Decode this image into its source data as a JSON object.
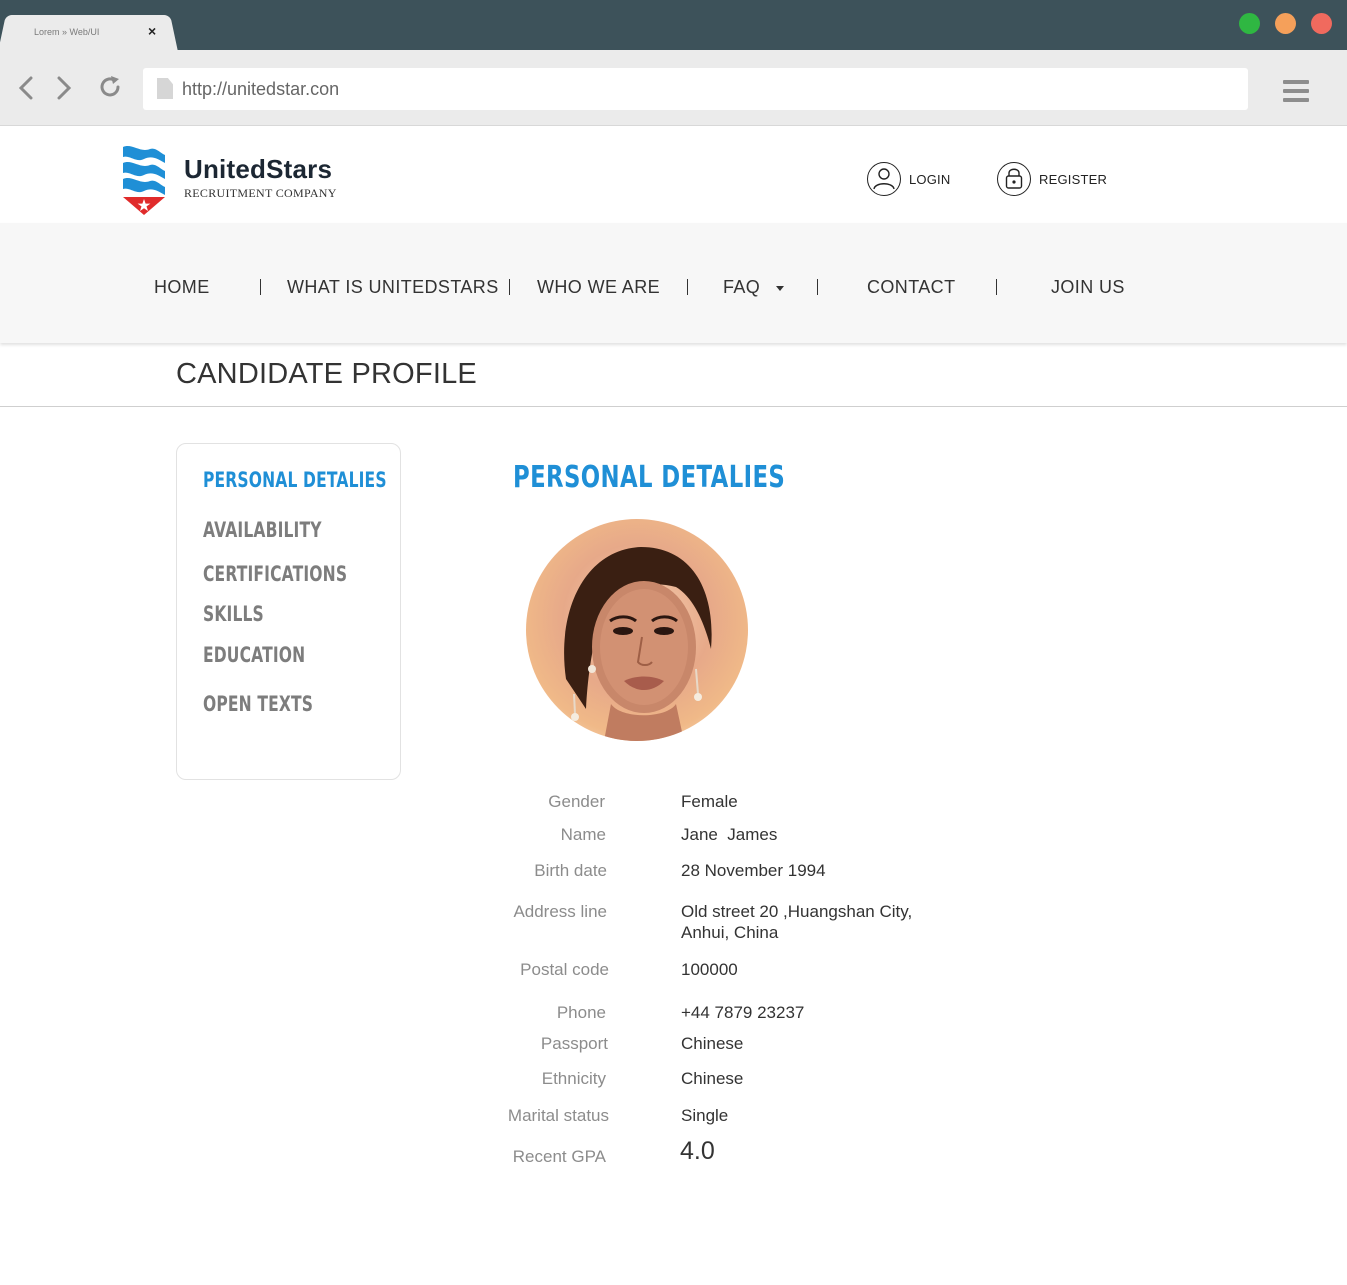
{
  "browser": {
    "tab_title": "Lorem » Web/UI",
    "tab_close": "×",
    "url": "http://unitedstar.con",
    "window_dots": [
      "#2fb742",
      "#f5a05a",
      "#f06a5e"
    ]
  },
  "header": {
    "brand_name": "UnitedStars",
    "brand_subtitle": "RECRUITMENT COMPANY",
    "login_label": "LOGIN",
    "register_label": "REGISTER"
  },
  "nav": {
    "items": [
      "HOME",
      "WHAT IS UNITEDSTARS",
      "WHO WE ARE",
      "FAQ",
      "CONTACT",
      "JOIN US"
    ]
  },
  "page": {
    "title": "CANDIDATE PROFILE",
    "section_title": "PERSONAL DETALIES"
  },
  "sidebar": {
    "items": [
      "PERSONAL DETALIES",
      "AVAILABILITY",
      "CERTIFICATIONS",
      "SKILLS",
      "EDUCATION",
      "OPEN TEXTS"
    ],
    "active": "PERSONAL DETALIES"
  },
  "profile": {
    "fields": [
      {
        "label": "Gender",
        "value": "Female"
      },
      {
        "label": "Name",
        "value": "Jane  James"
      },
      {
        "label": "Birth date",
        "value": "28 November 1994"
      },
      {
        "label": "Address line",
        "value": "Old street 20 ,Huangshan City,",
        "value2": "Anhui, China"
      },
      {
        "label": "Postal code",
        "value": "100000"
      },
      {
        "label": "Phone",
        "value": "+44 7879 23237"
      },
      {
        "label": "Passport",
        "value": "Chinese"
      },
      {
        "label": "Ethnicity",
        "value": "Chinese"
      },
      {
        "label": "Marital status",
        "value": "Single"
      },
      {
        "label": "Recent GPA",
        "value": "4.0"
      }
    ]
  },
  "colors": {
    "accent": "#1f8fd6",
    "chrome_dark": "#3d525a",
    "logo_blue": "#1f8fd6",
    "logo_red": "#e02b2b"
  }
}
